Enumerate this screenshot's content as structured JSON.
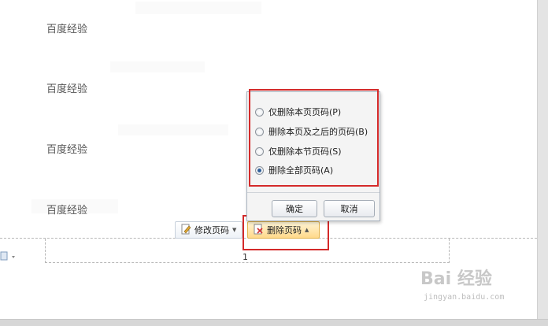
{
  "document": {
    "lines": [
      "百度经验",
      "百度经验",
      "百度经验",
      "百度经验"
    ],
    "page_number": "1"
  },
  "toolbar": {
    "modify_label": "修改页码",
    "delete_label": "删除页码",
    "modify_icon": "edit-page-icon",
    "delete_icon": "delete-page-icon"
  },
  "popup": {
    "options": [
      {
        "label": "仅删除本页页码(P)",
        "checked": false
      },
      {
        "label": "删除本页及之后的页码(B)",
        "checked": false
      },
      {
        "label": "仅删除本节页码(S)",
        "checked": false
      },
      {
        "label": "删除全部页码(A)",
        "checked": true
      }
    ],
    "ok_label": "确定",
    "cancel_label": "取消"
  },
  "watermark": {
    "logo": "Bai 经验",
    "url": "jingyan.baidu.com"
  },
  "colors": {
    "highlight": "#d42a2a",
    "delete_button": "#ffd98a",
    "radio_checked": "#2f5f9a"
  }
}
